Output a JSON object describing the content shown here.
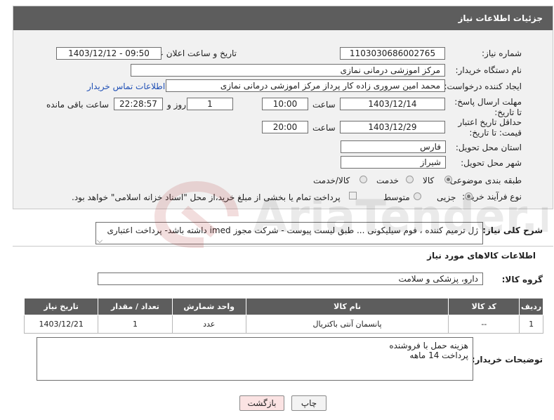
{
  "header": {
    "title": "جزئیات اطلاعات نیاز"
  },
  "labels": {
    "need_number": "شماره نیاز:",
    "announce_datetime": "تاریخ و ساعت اعلان عمومی:",
    "buyer_org": "نام دستگاه خریدار:",
    "requester": "ایجاد کننده درخواست:",
    "reply_deadline": "مهلت ارسال پاسخ: تا تاریخ:",
    "price_validity": "حداقل تاریخ اعتبار قیمت: تا تاریخ:",
    "province": "استان محل تحویل:",
    "city": "شهر محل تحویل:",
    "category": "طبقه بندی موضوعی:",
    "purchase_type": "نوع فرآیند خرید :",
    "time": "ساعت",
    "days_and": "روز و",
    "hours_left": "ساعت باقی مانده",
    "need_desc": "شرح کلی نیاز:",
    "goods_info": "اطلاعات کالاهای مورد نیاز",
    "goods_group": "گروه کالا:",
    "buyer_notes": "توضیحات خریدار:"
  },
  "fields": {
    "need_number": "1103030686002765",
    "announce_datetime": "1403/12/12 - 09:50",
    "buyer_org": "مرکز اموزشی درمانی نمازی",
    "requester": "محمد امین سروری زاده کار پرداز مرکز اموزشی درمانی نمازی",
    "contact_link": "اطلاعات تماس خریدار",
    "reply_date": "1403/12/14",
    "reply_time": "10:00",
    "reply_days": "1",
    "reply_remaining": "22:28:57",
    "validity_date": "1403/12/29",
    "validity_time": "20:00",
    "province": "فارس",
    "city": "شیراز",
    "need_desc": "ژل ترمیم کننده ، فوم سیلیکونی ... طبق لیست پیوست - شرکت مجوز imed داشته باشد- پرداخت اعتباری",
    "goods_group": "دارو، پزشکی و سلامت",
    "buyer_notes_line1": "هزینه حمل با فروشنده",
    "buyer_notes_line2": "پرداخت 14 ماهه"
  },
  "category_options": {
    "goods": "کالا",
    "service": "خدمت",
    "goods_service": "کالا/خدمت",
    "selected": "کالا"
  },
  "purchase_options": {
    "minor": "جزیی",
    "medium": "متوسط",
    "selected": "جزیی",
    "treasury_note": "پرداخت تمام یا بخشی از مبلغ خرید،از محل \"اسناد خزانه اسلامی\" خواهد بود."
  },
  "table": {
    "headers": [
      "ردیف",
      "کد کالا",
      "نام کالا",
      "واحد شمارش",
      "تعداد / مقدار",
      "تاریخ نیاز"
    ],
    "rows": [
      [
        "1",
        "--",
        "پانسمان آنتی باکتریال",
        "عدد",
        "1",
        "1403/12/21"
      ]
    ]
  },
  "buttons": {
    "print": "چاپ",
    "back": "بازگشت"
  },
  "watermark": "AriaTender.net",
  "colors": {
    "header_bg": "#5d5d5d",
    "link": "#1f4fb5",
    "back_btn_bg": "#fbe3e3"
  }
}
